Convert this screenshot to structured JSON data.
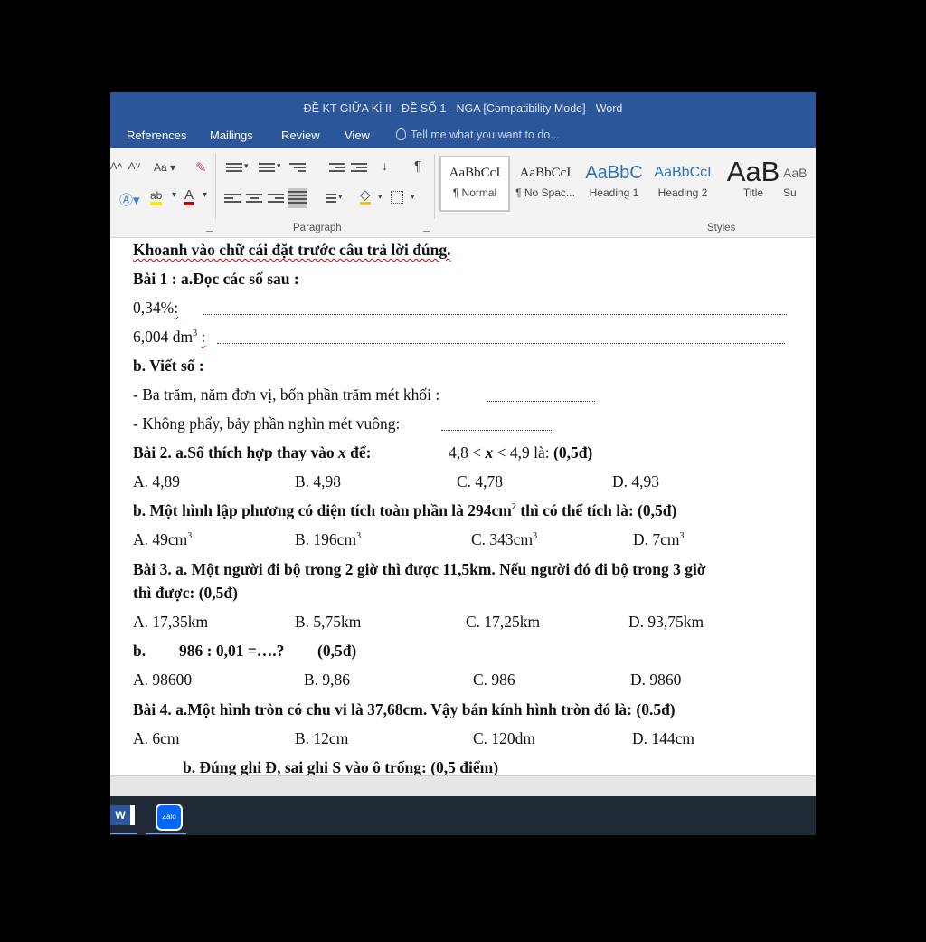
{
  "window": {
    "title": "ĐỀ KT GIỮA KÌ II - ĐỀ SỐ 1 - NGA [Compatibility Mode] - Word"
  },
  "tabs": [
    "References",
    "Mailings",
    "Review",
    "View"
  ],
  "tell_me": "Tell me what you want to do...",
  "ribbon": {
    "font_case": "Aa",
    "paragraph_label": "Paragraph",
    "styles_label": "Styles",
    "styles": [
      {
        "preview": "AaBbCcI",
        "name": "¶ Normal",
        "color": "#222222"
      },
      {
        "preview": "AaBbCcI",
        "name": "¶ No Spac...",
        "color": "#222222"
      },
      {
        "preview": "AaBbC",
        "name": "Heading 1",
        "color": "#2e74b5"
      },
      {
        "preview": "AaBbCcI",
        "name": "Heading 2",
        "color": "#2e74b5"
      },
      {
        "preview": "AaB",
        "name": "Title",
        "color": "#222222"
      },
      {
        "preview": "AaB",
        "name": "Su",
        "color": "#666666"
      }
    ]
  },
  "document": {
    "l1": "Khoanh vào chữ cái đặt trước câu trả lời đúng.",
    "l2": "Bài 1 : a.Đọc các số sau :",
    "l3": "0,34%",
    "l3b": ":",
    "l4a": "6,004 dm",
    "l4sup": "3",
    "l4b": ":",
    "l5": "b. Viết số :",
    "l6": "- Ba trăm, năm đơn vị, bốn phần trăm mét khối :",
    "l7": "- Không phẩy, bảy phần nghìn mét vuông:",
    "l8a": "Bài 2. a.Số thích hợp thay vào",
    "l8x": "x",
    "l8b": "để:",
    "l8c": "4,8 <",
    "l8d": "< 4,9 là:",
    "l8e": "(0,5đ)",
    "q2a": [
      "A. 4,89",
      "B. 4,98",
      "C. 4,78",
      "D. 4,93"
    ],
    "l10a": "b. Một hình lập phương có diện tích toàn phần là 294cm",
    "l10sup": "2",
    "l10b": "thì có thể tích là: (0,5đ)",
    "q2b": [
      {
        "v": "A. 49cm",
        "s": "3"
      },
      {
        "v": "B.  196cm",
        "s": "3"
      },
      {
        "v": "C. 343cm",
        "s": "3"
      },
      {
        "v": "D. 7cm",
        "s": "3"
      }
    ],
    "l12": "Bài 3. a. Một người đi bộ trong 2 giờ thì được 11,5km. Nếu người đó đi bộ trong 3 giờ",
    "l13": "thì được: (0,5đ)",
    "q3a": [
      "A. 17,35km",
      "B. 5,75km",
      "C. 17,25km",
      "D. 93,75km"
    ],
    "l15a": "b.",
    "l15b": "986 : 0,01 =….?",
    "l15c": "(0,5đ)",
    "q3b": [
      "A. 98600",
      "B. 9,86",
      "C. 986",
      "D. 9860"
    ],
    "l17": "Bài 4.  a.Một hình tròn có chu vi là 37,68cm. Vậy bán kính hình tròn đó là:  (0.5đ)",
    "q4a": [
      "A. 6cm",
      "B. 12cm",
      "C. 120dm",
      "D. 144cm"
    ],
    "l19": "b. Đúng ghi Đ, sai ghi S vào ô trống:  (0,5 điểm)"
  },
  "taskbar": {
    "word_icon": "word-icon",
    "zalo_label": "Zalo"
  }
}
